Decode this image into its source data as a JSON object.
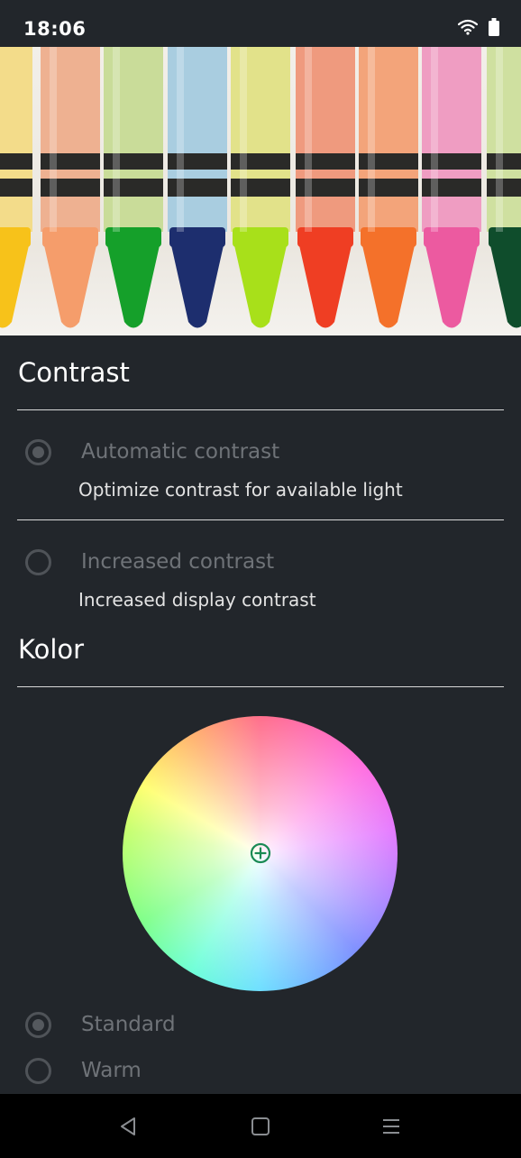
{
  "status_bar": {
    "time": "18:06",
    "icons": [
      "wifi-icon",
      "battery-icon"
    ]
  },
  "header_image": {
    "subject": "crayons",
    "crayon_colors": [
      "#f7c21a",
      "#f59d6b",
      "#15a02a",
      "#1d2e6e",
      "#a8e01a",
      "#ef3e23",
      "#f4712a",
      "#ec5aa0",
      "#0f4d2c"
    ]
  },
  "contrast": {
    "title": "Contrast",
    "options": [
      {
        "label": "Automatic contrast",
        "description": "Optimize contrast for available light",
        "selected": true
      },
      {
        "label": "Increased contrast",
        "description": "Increased display contrast",
        "selected": false
      }
    ]
  },
  "color": {
    "title": "Kolor",
    "wheel_cursor_icon": "add-circle-icon",
    "modes": [
      {
        "label": "Standard",
        "selected": true
      },
      {
        "label": "Warm",
        "selected": false
      }
    ]
  },
  "nav_bar": {
    "icons": [
      "back-icon",
      "home-icon",
      "menu-icon"
    ]
  },
  "colors": {
    "background": "#22262b",
    "divider": "#d8d8d8",
    "disabled_text": "#6f7378",
    "cursor_green": "#1a8a55"
  }
}
